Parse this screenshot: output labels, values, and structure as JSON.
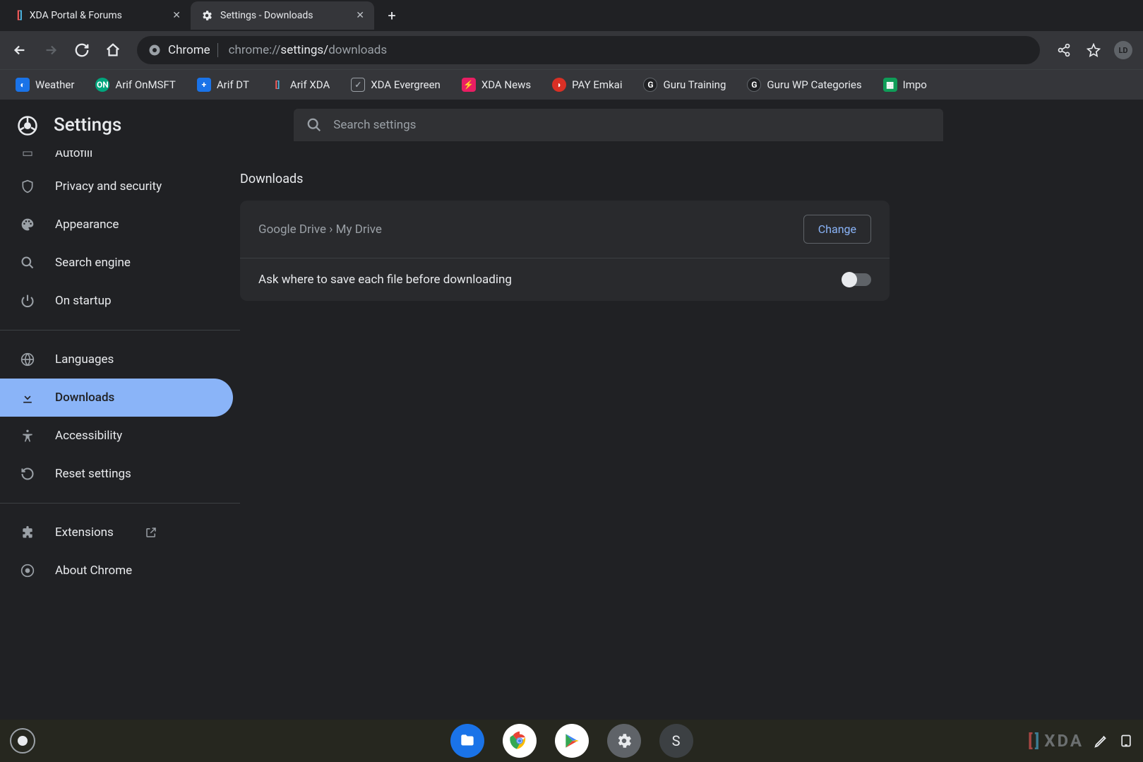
{
  "tabs": [
    {
      "title": "XDA Portal & Forums",
      "icon_color1": "#ff5c5c",
      "icon_color2": "#4db6e3"
    },
    {
      "title": "Settings - Downloads"
    }
  ],
  "toolbar": {
    "site_label": "Chrome",
    "url_prefix": "chrome://",
    "url_bold": "settings/",
    "url_suffix": "downloads"
  },
  "bookmarks": [
    {
      "label": "Weather",
      "bg": "#1a73e8",
      "glyph": "◐"
    },
    {
      "label": "Arif OnMSFT",
      "bg": "#00a67d",
      "glyph": "ON"
    },
    {
      "label": "Arif DT",
      "bg": "#1a73e8",
      "glyph": "+"
    },
    {
      "label": "Arif XDA",
      "bg": "transparent",
      "glyph": "⎡⎦"
    },
    {
      "label": "XDA Evergreen",
      "bg": "#5f6368",
      "glyph": "☑"
    },
    {
      "label": "XDA News",
      "bg": "#e91e63",
      "glyph": "⚡"
    },
    {
      "label": "PAY Emkai",
      "bg": "#d93025",
      "glyph": "◗"
    },
    {
      "label": "Guru Training",
      "bg": "#202124",
      "glyph": "G"
    },
    {
      "label": "Guru WP Categories",
      "bg": "#202124",
      "glyph": "G"
    },
    {
      "label": "Impo",
      "bg": "#0f9d58",
      "glyph": "▦"
    }
  ],
  "settings": {
    "title": "Settings",
    "search_placeholder": "Search settings"
  },
  "sidebar": {
    "items": [
      {
        "label": "Autofill",
        "icon": "autofill"
      },
      {
        "label": "Privacy and security",
        "icon": "shield"
      },
      {
        "label": "Appearance",
        "icon": "palette"
      },
      {
        "label": "Search engine",
        "icon": "search"
      },
      {
        "label": "On startup",
        "icon": "power"
      }
    ],
    "advanced": [
      {
        "label": "Languages",
        "icon": "globe"
      },
      {
        "label": "Downloads",
        "icon": "download",
        "selected": true
      },
      {
        "label": "Accessibility",
        "icon": "accessibility"
      },
      {
        "label": "Reset settings",
        "icon": "reset"
      }
    ],
    "footer": [
      {
        "label": "Extensions",
        "icon": "extension",
        "external": true
      },
      {
        "label": "About Chrome",
        "icon": "chrome"
      }
    ]
  },
  "content": {
    "section_title": "Downloads",
    "location": "Google Drive › My Drive",
    "change_label": "Change",
    "ask_label": "Ask where to save each file before downloading",
    "ask_value": false
  },
  "shelf": {
    "avatar_letter": "S"
  },
  "watermark": "XDA"
}
